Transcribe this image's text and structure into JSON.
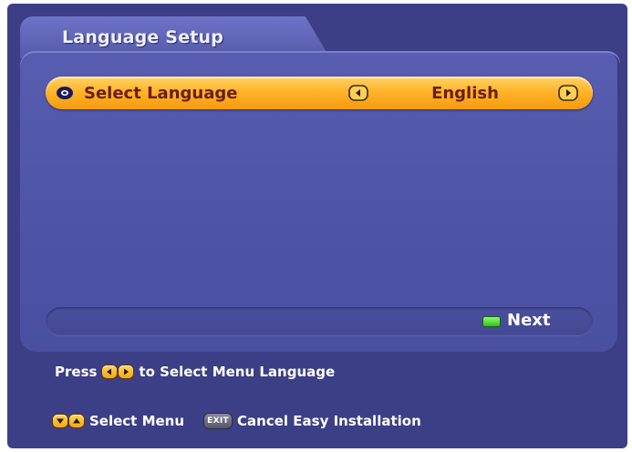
{
  "header": {
    "title": "Language Setup"
  },
  "selection": {
    "label": "Select Language",
    "value": "English"
  },
  "footer_bar": {
    "next_label": "Next"
  },
  "help": {
    "line1_prefix": "Press",
    "line1_suffix": "to Select Menu Language",
    "select_menu": "Select Menu",
    "exit_key": "EXIT",
    "cancel": "Cancel Easy Installation"
  },
  "colors": {
    "background": "#3c3f86",
    "panel": "#5459a8",
    "highlight": "#ffb52a",
    "text_highlight": "#6a1e10",
    "next_key": "#2fbf1f"
  },
  "icons": {
    "bullet": "ring-bullet-icon",
    "left": "left-arrow-icon",
    "right": "right-arrow-icon",
    "next": "green-key-icon"
  }
}
